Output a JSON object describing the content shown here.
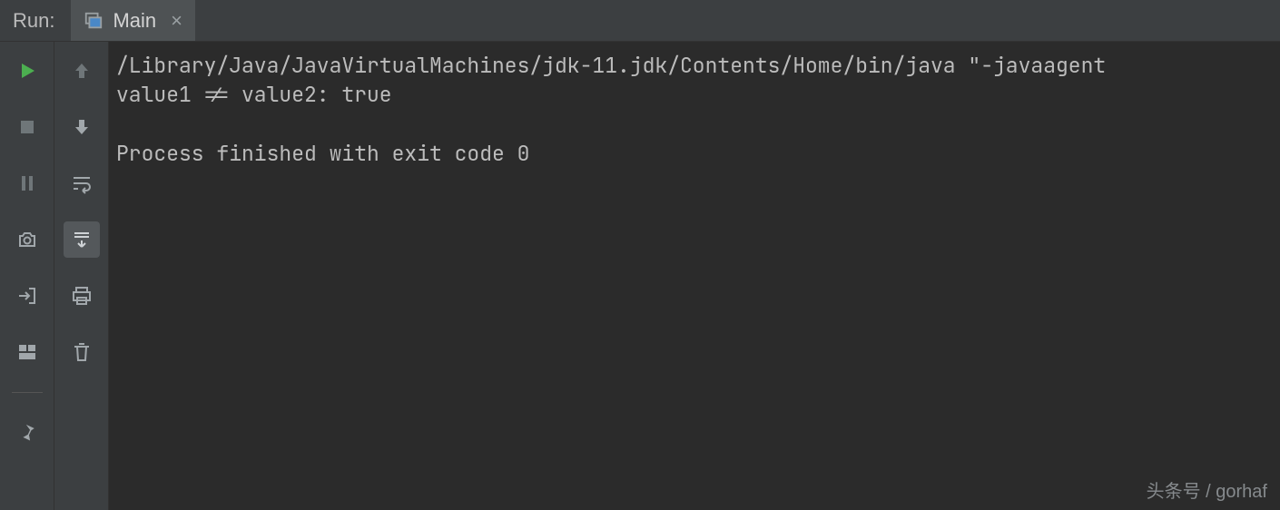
{
  "header": {
    "run_label": "Run:",
    "tab_label": "Main",
    "tab_close": "×"
  },
  "console": {
    "line1": "/Library/Java/JavaVirtualMachines/jdk-11.jdk/Contents/Home/bin/java \"-javaagent",
    "line2": "value1 != value2: true",
    "blank": "",
    "line3": "Process finished with exit code 0"
  },
  "watermark": "头条号 / gorhaf",
  "icons": {
    "play": "play-icon",
    "stop": "stop-icon",
    "pause": "pause-icon",
    "camera": "camera-icon",
    "exit": "exit-icon",
    "layout": "layout-icon",
    "pin": "pin-icon",
    "up": "arrow-up-icon",
    "down": "arrow-down-icon",
    "wrap": "soft-wrap-icon",
    "scroll": "scroll-to-end-icon",
    "print": "print-icon",
    "trash": "trash-icon"
  }
}
